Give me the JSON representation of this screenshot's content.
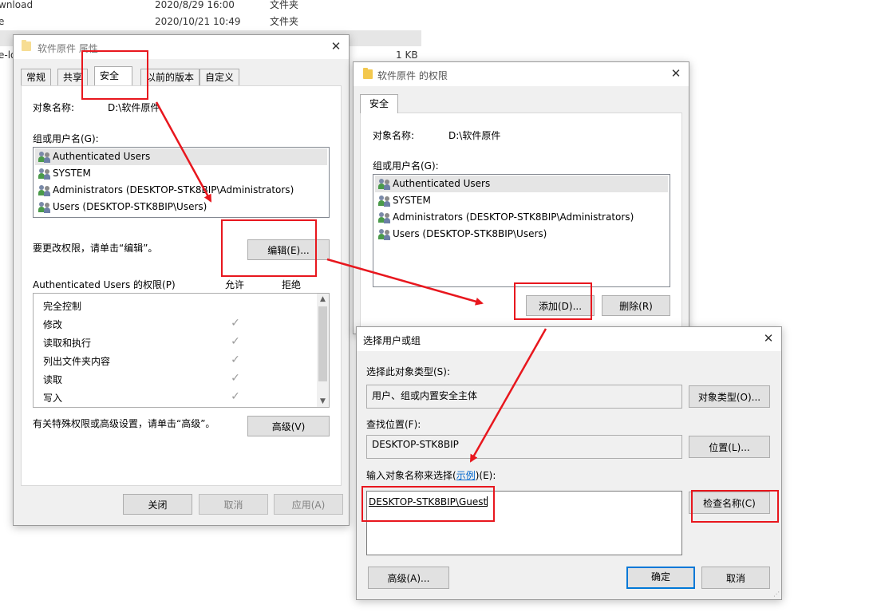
{
  "background_rows": [
    {
      "name": "wnload",
      "date": "2020/8/29 16:00",
      "type": "文件夹",
      "size": ""
    },
    {
      "name": "e",
      "date": "2020/10/21 10:49",
      "type": "文件夹",
      "size": ""
    },
    {
      "name": "e-lo",
      "date": "",
      "type": "",
      "size": "1 KB"
    }
  ],
  "properties_dialog": {
    "title": "软件原件 属性",
    "tabs": [
      "常规",
      "共享",
      "安全",
      "以前的版本",
      "自定义"
    ],
    "object_name_label": "对象名称:",
    "object_name_value": "D:\\软件原件",
    "group_label": "组或用户名(G):",
    "users": [
      "Authenticated Users",
      "SYSTEM",
      "Administrators (DESKTOP-STK8BIP\\Administrators)",
      "Users (DESKTOP-STK8BIP\\Users)"
    ],
    "edit_hint": "要更改权限，请单击“编辑”。",
    "edit_button": "编辑(E)...",
    "perm_header": "Authenticated Users 的权限(P)",
    "allow_label": "允许",
    "deny_label": "拒绝",
    "permissions": [
      "完全控制",
      "修改",
      "读取和执行",
      "列出文件夹内容",
      "读取",
      "写入"
    ],
    "check_glyph": "✓",
    "advanced_hint": "有关特殊权限或高级设置，请单击“高级”。",
    "advanced_button": "高级(V)",
    "close_button": "关闭",
    "cancel_button": "取消",
    "apply_button": "应用(A)"
  },
  "permissions_dialog": {
    "title": "软件原件 的权限",
    "tab": "安全",
    "object_name_label": "对象名称:",
    "object_name_value": "D:\\软件原件",
    "group_label": "组或用户名(G):",
    "users": [
      "Authenticated Users",
      "SYSTEM",
      "Administrators (DESKTOP-STK8BIP\\Administrators)",
      "Users (DESKTOP-STK8BIP\\Users)"
    ],
    "add_button": "添加(D)...",
    "remove_button": "删除(R)"
  },
  "select_dialog": {
    "title": "选择用户或组",
    "type_label": "选择此对象类型(S):",
    "type_value": "用户、组或内置安全主体",
    "object_types_button": "对象类型(O)...",
    "location_label": "查找位置(F):",
    "location_value": "DESKTOP-STK8BIP",
    "location_button": "位置(L)...",
    "enter_label_prefix": "输入对象名称来选择(",
    "enter_label_link": "示例",
    "enter_label_suffix": ")(E):",
    "entered_name": "DESKTOP-STK8BIP\\Guest",
    "check_names_button": "检查名称(C)",
    "advanced_button": "高级(A)...",
    "ok_button": "确定",
    "cancel_button": "取消"
  },
  "colors": {
    "annotation_red": "#e8171e",
    "link_blue": "#0066cc",
    "primary_border": "#0078d7"
  }
}
